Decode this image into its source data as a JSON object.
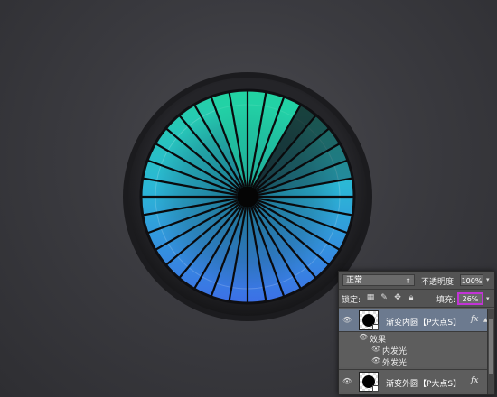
{
  "dial": {
    "segments": 36,
    "highlighted_segments": 5,
    "colors": {
      "teal": "#20d6a0",
      "cyan": "#2cc8e0",
      "blue": "#3a7fe0",
      "deep_blue": "#3a55c0",
      "dim": "#1e2a2e",
      "ring_dark": "#1c1c20"
    }
  },
  "layers_panel": {
    "blend_mode": "正常",
    "opacity_label": "不透明度:",
    "opacity_value": "100%",
    "lock_label": "锁定:",
    "lock_icons": [
      "lock-transparent-icon",
      "lock-paint-icon",
      "lock-move-icon",
      "lock-all-icon"
    ],
    "fill_label": "填充:",
    "fill_value": "26%",
    "fill_highlight_color": "#c234d6",
    "layers": [
      {
        "name": "渐变内圆【P大点S】",
        "fx": "fx",
        "selected": true,
        "effects_label": "效果",
        "effects": [
          "内发光",
          "外发光"
        ]
      },
      {
        "name": "渐变外圆【P大点S】",
        "fx": "fx",
        "selected": false
      }
    ]
  }
}
